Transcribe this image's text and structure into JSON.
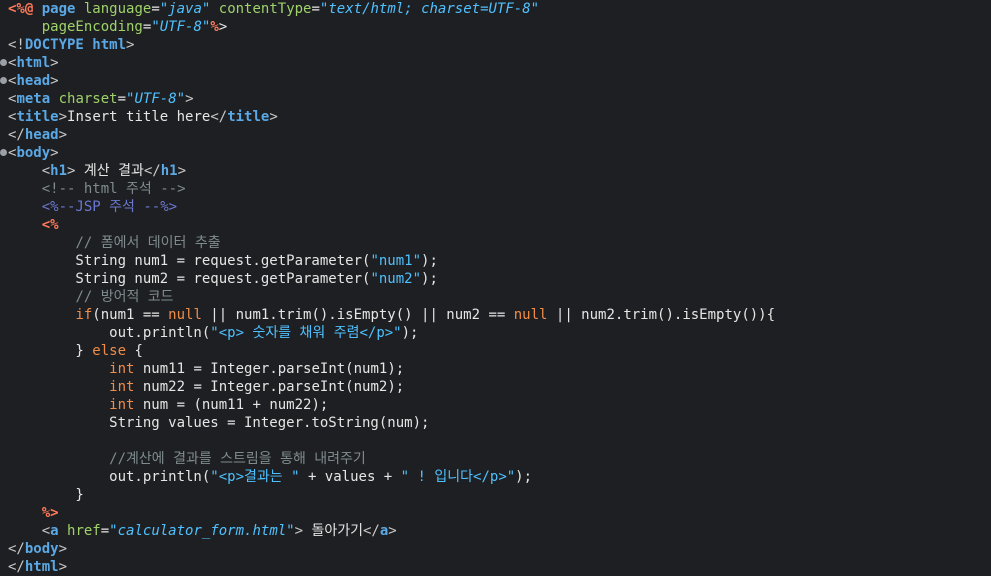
{
  "editor": {
    "lines": [
      {
        "fold": false,
        "segs": [
          [
            "jspd",
            "<%@ "
          ],
          [
            "tagname",
            "page "
          ],
          [
            "attr",
            "language"
          ],
          [
            "plain",
            "="
          ],
          [
            "str",
            "\"java\" "
          ],
          [
            "attr",
            "contentType"
          ],
          [
            "plain",
            "="
          ],
          [
            "str",
            "\"text/html; charset=UTF-8\""
          ]
        ]
      },
      {
        "fold": false,
        "segs": [
          [
            "plain",
            "    "
          ],
          [
            "attr",
            "pageEncoding"
          ],
          [
            "plain",
            "="
          ],
          [
            "str",
            "\"UTF-8\""
          ],
          [
            "jspd",
            "%"
          ],
          [
            "plain",
            ">"
          ]
        ]
      },
      {
        "fold": false,
        "segs": [
          [
            "bracket",
            "<!"
          ],
          [
            "tagname",
            "DOCTYPE "
          ],
          [
            "tagname",
            "html"
          ],
          [
            "bracket",
            ">"
          ]
        ]
      },
      {
        "fold": true,
        "segs": [
          [
            "bracket",
            "<"
          ],
          [
            "tagname",
            "html"
          ],
          [
            "bracket",
            ">"
          ]
        ]
      },
      {
        "fold": true,
        "segs": [
          [
            "bracket",
            "<"
          ],
          [
            "tagname",
            "head"
          ],
          [
            "bracket",
            ">"
          ]
        ]
      },
      {
        "fold": false,
        "segs": [
          [
            "bracket",
            "<"
          ],
          [
            "tagname",
            "meta "
          ],
          [
            "attr",
            "charset"
          ],
          [
            "plain",
            "="
          ],
          [
            "str",
            "\"UTF-8\""
          ],
          [
            "bracket",
            ">"
          ]
        ]
      },
      {
        "fold": false,
        "segs": [
          [
            "bracket",
            "<"
          ],
          [
            "tagname",
            "title"
          ],
          [
            "bracket",
            ">"
          ],
          [
            "plain",
            "Insert title here"
          ],
          [
            "bracket",
            "</"
          ],
          [
            "tagname",
            "title"
          ],
          [
            "bracket",
            ">"
          ]
        ]
      },
      {
        "fold": false,
        "segs": [
          [
            "bracket",
            "</"
          ],
          [
            "tagname",
            "head"
          ],
          [
            "bracket",
            ">"
          ]
        ]
      },
      {
        "fold": true,
        "segs": [
          [
            "bracket",
            "<"
          ],
          [
            "tagname",
            "body"
          ],
          [
            "bracket",
            ">"
          ]
        ]
      },
      {
        "fold": false,
        "segs": [
          [
            "plain",
            "    "
          ],
          [
            "bracket",
            "<"
          ],
          [
            "tagname",
            "h1"
          ],
          [
            "bracket",
            ">"
          ],
          [
            "plain",
            " 계산 결과"
          ],
          [
            "bracket",
            "</"
          ],
          [
            "tagname",
            "h1"
          ],
          [
            "bracket",
            ">"
          ]
        ]
      },
      {
        "fold": false,
        "segs": [
          [
            "plain",
            "    "
          ],
          [
            "comment",
            "<!-- "
          ],
          [
            "comment",
            "html"
          ],
          [
            "comment",
            " 주석 -->"
          ]
        ]
      },
      {
        "fold": false,
        "segs": [
          [
            "plain",
            "    "
          ],
          [
            "jspcomment",
            "<%--JSP 주석 --%>"
          ]
        ]
      },
      {
        "fold": false,
        "segs": [
          [
            "plain",
            "    "
          ],
          [
            "jspd",
            "<%"
          ]
        ]
      },
      {
        "fold": false,
        "segs": [
          [
            "plain",
            "        "
          ],
          [
            "comment",
            "// 폼에서 데이터 추출"
          ]
        ]
      },
      {
        "fold": false,
        "segs": [
          [
            "plain",
            "        String num1 = request.getParameter("
          ],
          [
            "jstr",
            "\"num1\""
          ],
          [
            "plain",
            ");"
          ]
        ]
      },
      {
        "fold": false,
        "segs": [
          [
            "plain",
            "        String num2 = request.getParameter("
          ],
          [
            "jstr",
            "\"num2\""
          ],
          [
            "plain",
            ");"
          ]
        ]
      },
      {
        "fold": false,
        "segs": [
          [
            "plain",
            "        "
          ],
          [
            "comment",
            "// 방어적 코드"
          ]
        ]
      },
      {
        "fold": false,
        "segs": [
          [
            "plain",
            "        "
          ],
          [
            "kw",
            "if"
          ],
          [
            "plain",
            "(num1 == "
          ],
          [
            "kw",
            "null"
          ],
          [
            "plain",
            " || num1.trim().isEmpty() || num2 == "
          ],
          [
            "kw",
            "null"
          ],
          [
            "plain",
            " || num2.trim().isEmpty()){"
          ]
        ]
      },
      {
        "fold": false,
        "segs": [
          [
            "plain",
            "            out.println("
          ],
          [
            "jstr",
            "\"<p> 숫자를 채워 주렴</p>\""
          ],
          [
            "plain",
            ");"
          ]
        ]
      },
      {
        "fold": false,
        "segs": [
          [
            "plain",
            "        } "
          ],
          [
            "kw",
            "else"
          ],
          [
            "plain",
            " {"
          ]
        ]
      },
      {
        "fold": false,
        "segs": [
          [
            "plain",
            "            "
          ],
          [
            "kw",
            "int"
          ],
          [
            "plain",
            " num11 = Integer.parseInt(num1);"
          ]
        ]
      },
      {
        "fold": false,
        "segs": [
          [
            "plain",
            "            "
          ],
          [
            "kw",
            "int"
          ],
          [
            "plain",
            " num22 = Integer.parseInt(num2);"
          ]
        ]
      },
      {
        "fold": false,
        "segs": [
          [
            "plain",
            "            "
          ],
          [
            "kw",
            "int"
          ],
          [
            "plain",
            " num = (num11 + num22);"
          ]
        ]
      },
      {
        "fold": false,
        "segs": [
          [
            "plain",
            "            String values = Integer.toString(num);"
          ]
        ]
      },
      {
        "fold": false,
        "segs": [
          [
            "plain",
            ""
          ]
        ]
      },
      {
        "fold": false,
        "segs": [
          [
            "plain",
            "            "
          ],
          [
            "comment",
            "//계산에 결과를 스트림을 통해 내려주기"
          ]
        ]
      },
      {
        "fold": false,
        "segs": [
          [
            "plain",
            "            out.println("
          ],
          [
            "jstr",
            "\"<p>결과는 \""
          ],
          [
            "plain",
            " + values + "
          ],
          [
            "jstr",
            "\" ! 입니다</p>\""
          ],
          [
            "plain",
            ");"
          ]
        ]
      },
      {
        "fold": false,
        "segs": [
          [
            "plain",
            "        }"
          ]
        ]
      },
      {
        "fold": false,
        "segs": [
          [
            "plain",
            "    "
          ],
          [
            "jspd",
            "%>"
          ]
        ]
      },
      {
        "fold": false,
        "segs": [
          [
            "plain",
            "    "
          ],
          [
            "bracket",
            "<"
          ],
          [
            "tagname",
            "a "
          ],
          [
            "attr",
            "href"
          ],
          [
            "plain",
            "="
          ],
          [
            "str",
            "\"calculator_form.html\""
          ],
          [
            "bracket",
            ">"
          ],
          [
            "plain",
            " 돌아가기"
          ],
          [
            "bracket",
            "</"
          ],
          [
            "tagname",
            "a"
          ],
          [
            "bracket",
            ">"
          ]
        ]
      },
      {
        "fold": false,
        "segs": [
          [
            "bracket",
            "</"
          ],
          [
            "tagname",
            "body"
          ],
          [
            "bracket",
            ">"
          ]
        ]
      },
      {
        "fold": false,
        "segs": [
          [
            "bracket",
            "</"
          ],
          [
            "tagname",
            "html"
          ],
          [
            "bracket",
            ">"
          ]
        ]
      }
    ]
  }
}
